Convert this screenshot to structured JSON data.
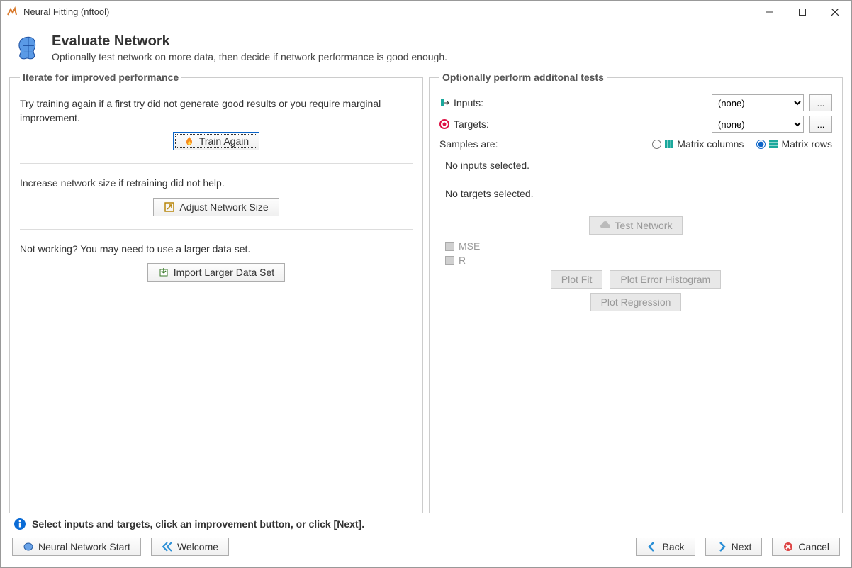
{
  "window": {
    "title": "Neural Fitting (nftool)"
  },
  "header": {
    "title": "Evaluate Network",
    "subtitle": "Optionally test network on more data, then decide if network performance is good enough."
  },
  "left_panel": {
    "legend": "Iterate for improved performance",
    "train_text": "Try training again if a first try did not generate good results or you require marginal improvement.",
    "train_button": "Train Again",
    "adjust_text": "Increase network size if retraining did not help.",
    "adjust_button": "Adjust Network Size",
    "import_text": "Not working? You may need to use a larger data set.",
    "import_button": "Import Larger Data Set"
  },
  "right_panel": {
    "legend": "Optionally perform additonal tests",
    "inputs_label": "Inputs:",
    "inputs_value": "(none)",
    "targets_label": "Targets:",
    "targets_value": "(none)",
    "browse_label": "...",
    "samples_label": "Samples are:",
    "matrix_cols": "Matrix columns",
    "matrix_rows": "Matrix rows",
    "no_inputs": "No inputs selected.",
    "no_targets": "No targets selected.",
    "test_button": "Test Network",
    "mse_label": "MSE",
    "r_label": "R",
    "plot_fit": "Plot Fit",
    "plot_err": "Plot Error Histogram",
    "plot_reg": "Plot Regression"
  },
  "footer": {
    "info_text": "Select inputs and targets, click an improvement button, or click [Next].",
    "nn_start": "Neural Network Start",
    "welcome": "Welcome",
    "back": "Back",
    "next": "Next",
    "cancel": "Cancel"
  }
}
